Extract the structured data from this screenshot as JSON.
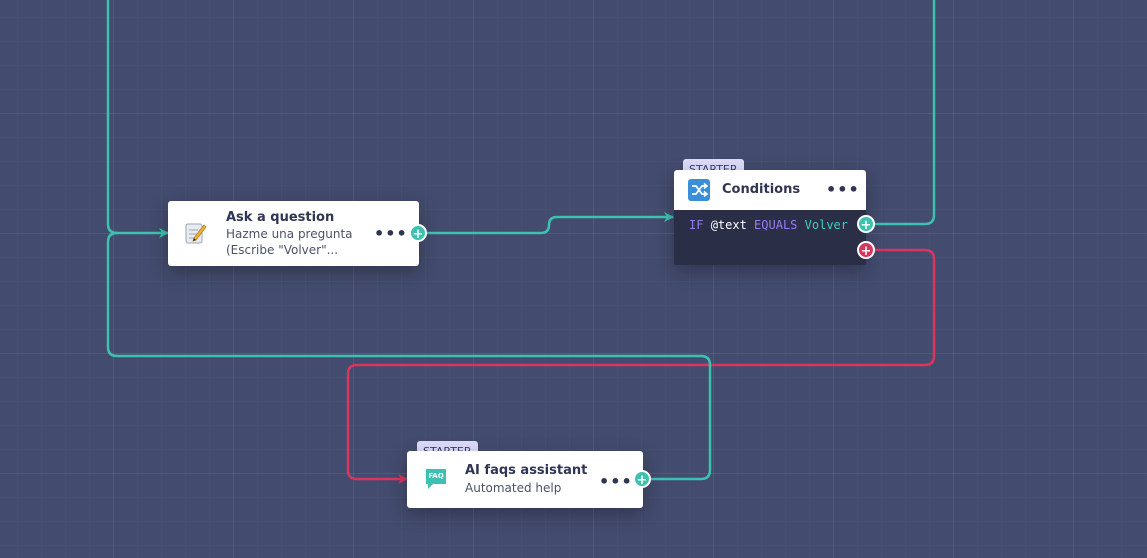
{
  "nodes": {
    "ask_question": {
      "title": "Ask a question",
      "subtitle_line1": "Hazme una pregunta",
      "subtitle_line2": "(Escribe \"Volver\"...",
      "menu": "•••",
      "port_symbol": "+"
    },
    "conditions": {
      "badge": "STARTER",
      "title": "Conditions",
      "menu": "•••",
      "rule": {
        "if_keyword": "IF",
        "variable": "@text",
        "operator": "EQUALS",
        "value": "Volver"
      },
      "true_port_symbol": "+",
      "false_port_symbol": "+"
    },
    "ai_faqs": {
      "badge": "STARTER",
      "title": "AI faqs assistant",
      "subtitle": "Automated help",
      "icon_text": "FAQ",
      "menu": "•••",
      "port_symbol": "+"
    }
  },
  "colors": {
    "canvas_background": "#434b6e",
    "edge_teal": "#3dc2b1",
    "edge_red": "#d8355f",
    "badge_background": "#dcdcfa",
    "condition_panel": "#2a2f47"
  },
  "icons": {
    "ask_question": "memo-pencil-icon",
    "conditions": "shuffle-icon",
    "ai_faqs": "faq-chat-bubble-icon"
  }
}
